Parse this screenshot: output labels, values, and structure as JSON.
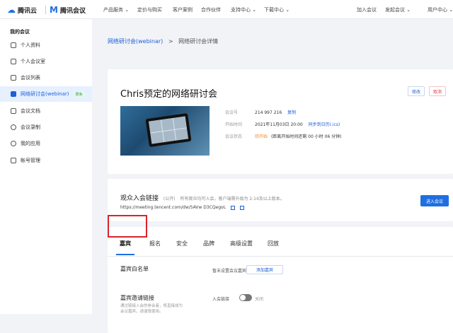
{
  "top": {
    "brand_yun": "腾讯云",
    "brand_meeting": "腾讯会议",
    "nav": [
      "产品服务 ⌄",
      "定价与购买",
      "客户案例",
      "合作伙伴",
      "支持中心 ⌄",
      "下载中心 ⌄",
      "加入会议",
      "发起会议 ⌄",
      "用户中心 ⌄"
    ]
  },
  "sidebar": {
    "title": "我的会议",
    "items": [
      {
        "label": "个人资料",
        "icon": "user-icon"
      },
      {
        "label": "个人会议室",
        "icon": "person-room-icon"
      },
      {
        "label": "会议列表",
        "icon": "list-icon"
      },
      {
        "label": "网络研讨会(webinar)",
        "icon": "webinar-icon",
        "badge": "限免",
        "active": true
      },
      {
        "label": "会议文档",
        "icon": "document-icon"
      },
      {
        "label": "会议录制",
        "icon": "record-icon"
      },
      {
        "label": "我的应用",
        "icon": "apps-icon"
      },
      {
        "label": "帐号管理",
        "icon": "account-icon"
      }
    ]
  },
  "breadcrumb": {
    "root": "网络研讨会(webinar)",
    "sep": ">",
    "current": "网络研讨会详情"
  },
  "meeting": {
    "title": "Chris预定的网络研讨会",
    "edit_label": "修改",
    "cancel_label": "取消",
    "id_label": "会议号",
    "id_value": "214 997 216",
    "copy_label": "复制",
    "time_label": "开始时间",
    "time_value": "2021年11月03日 20:00",
    "sync_label": "同步到日历(.ics)",
    "status_label": "会议状态",
    "status_value": "待开始",
    "status_note": "(距离开始时间还剩 00 小时 06 分钟)"
  },
  "audience": {
    "title": "观众入会链接",
    "title_suffix": "(公开)",
    "note": "所有观众均可入会，客户端需升级为 2.14及以上版本。",
    "url": "https://meeting.tencent.com/dw/5AVw D3CQegoL",
    "enter_label": "进入会议"
  },
  "tabs": [
    "嘉宾",
    "报名",
    "安全",
    "品牌",
    "高级设置",
    "回放"
  ],
  "guest_section": {
    "whitelist_title": "嘉宾白名单",
    "whitelist_status": "暂未设置会议嘉宾",
    "add_label": "添加嘉宾",
    "invite_title": "嘉宾邀请链接",
    "invite_toggle_label": "入会链接",
    "toggle_state": "关闭",
    "invite_desc_1": "通过链接入会的参会者，将直接成为",
    "invite_desc_2": "会议嘉宾，请谨慎使用。"
  },
  "colors": {
    "accent": "#1f6fe0",
    "warning": "#f08a24",
    "danger": "#d9232a",
    "badge_green": "#2fa05a"
  }
}
